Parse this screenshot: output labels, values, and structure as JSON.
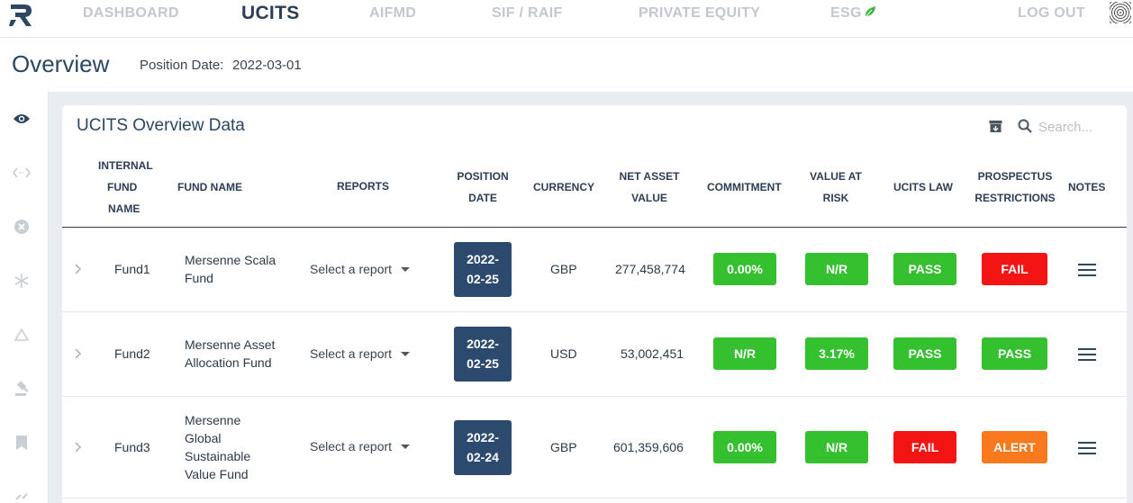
{
  "nav": {
    "items": [
      "DASHBOARD",
      "UCITS",
      "AIFMD",
      "SIF / RAIF",
      "PRIVATE EQUITY",
      "ESG"
    ],
    "logout": "LOG OUT",
    "active": "UCITS"
  },
  "header": {
    "title": "Overview",
    "position_date_label": "Position Date:",
    "position_date_value": "2022-03-01"
  },
  "sidebar": {
    "icons": [
      "eye-icon",
      "code-arrows-icon",
      "close-circle-icon",
      "snowflake-icon",
      "triangle-icon",
      "gavel-icon",
      "bookmark-icon",
      "chain-link-icon"
    ]
  },
  "card": {
    "title": "UCITS Overview Data",
    "search_placeholder": "Search...",
    "columns": {
      "internal_fund_name": [
        "INTERNAL",
        "FUND",
        "NAME"
      ],
      "fund_name": "FUND NAME",
      "reports": "REPORTS",
      "position_date": [
        "POSITION",
        "DATE"
      ],
      "currency": "CURRENCY",
      "nav": [
        "NET ASSET",
        "VALUE"
      ],
      "commitment": "COMMITMENT",
      "var": [
        "VALUE AT",
        "RISK"
      ],
      "ucits_law": "UCITS LAW",
      "prospectus": [
        "PROSPECTUS",
        "RESTRICTIONS"
      ],
      "notes": "NOTES"
    }
  },
  "rows": [
    {
      "internal": "Fund1",
      "fund_name": [
        "Mersenne Scala",
        "Fund"
      ],
      "report": "Select a report",
      "date": [
        "2022-",
        "02-25"
      ],
      "currency": "GBP",
      "nav": "277,458,774",
      "commitment": "0.00%",
      "var": "N/R",
      "ucits_law": "PASS",
      "prospectus": "FAIL"
    },
    {
      "internal": "Fund2",
      "fund_name": [
        "Mersenne Asset",
        "Allocation Fund"
      ],
      "report": "Select a report",
      "date": [
        "2022-",
        "02-25"
      ],
      "currency": "USD",
      "nav": "53,002,451",
      "commitment": "N/R",
      "var": "3.17%",
      "ucits_law": "PASS",
      "prospectus": "PASS"
    },
    {
      "internal": "Fund3",
      "fund_name": [
        "Mersenne",
        "Global",
        "Sustainable",
        "Value Fund"
      ],
      "report": "Select a report",
      "date": [
        "2022-",
        "02-24"
      ],
      "currency": "GBP",
      "nav": "601,359,606",
      "commitment": "0.00%",
      "var": "N/R",
      "ucits_law": "FAIL",
      "prospectus": "ALERT"
    }
  ],
  "colors": {
    "pass": "#35c12f",
    "fail": "#f31414",
    "alert": "#f97a1c",
    "date_badge": "#2c4a6e",
    "brand": "#2c4763"
  }
}
